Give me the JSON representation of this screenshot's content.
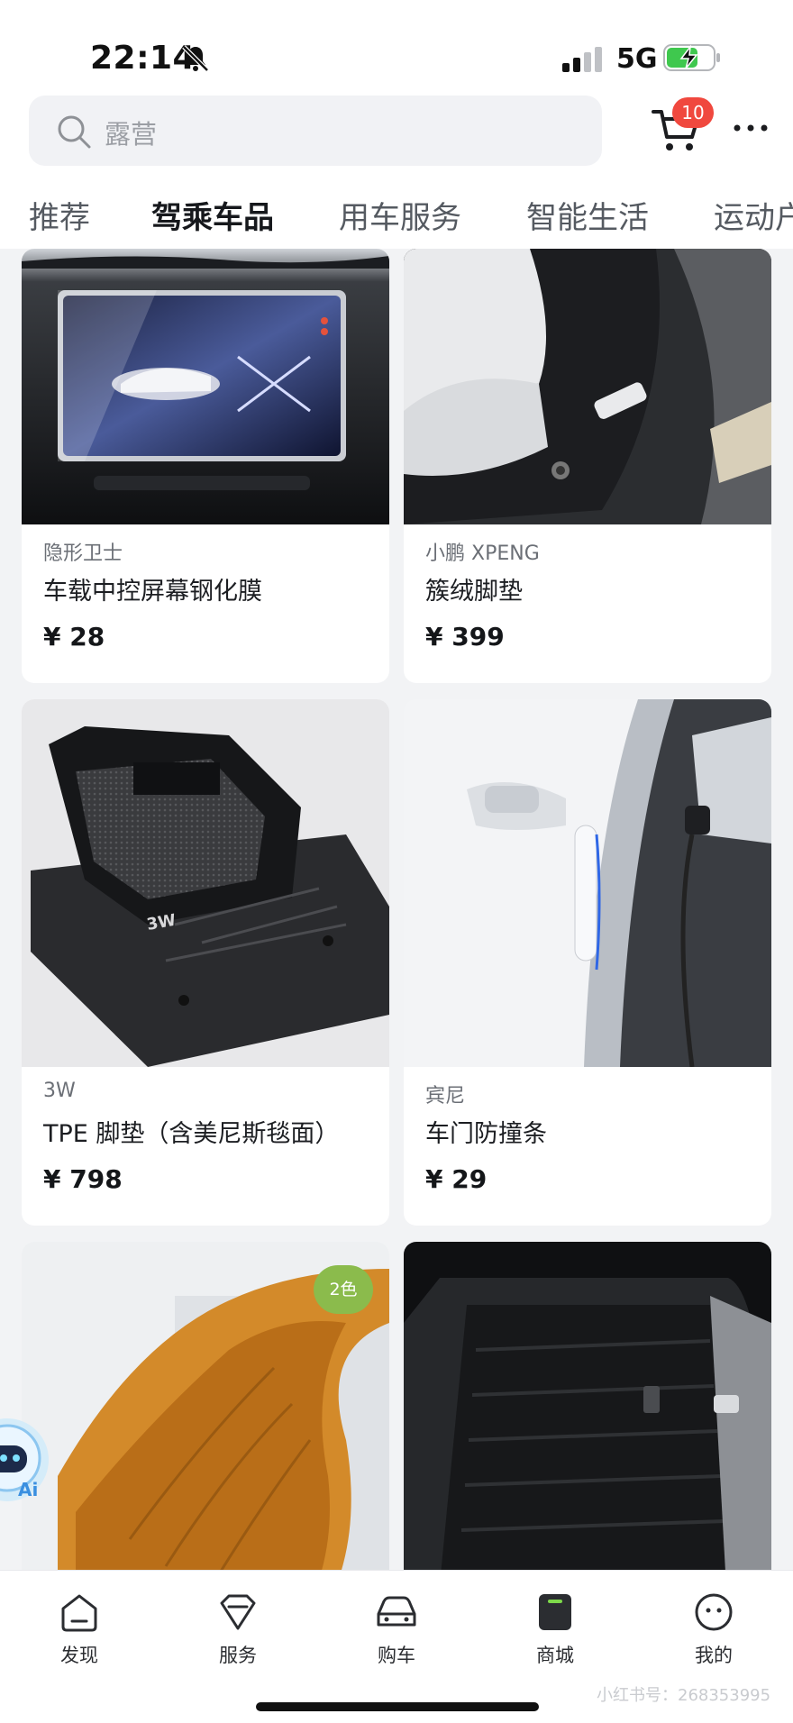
{
  "status_bar": {
    "time": "22:14",
    "network": "5G",
    "icons": [
      "bell-slash-icon",
      "signal-icon",
      "battery-charging-icon"
    ]
  },
  "search": {
    "placeholder": "露营"
  },
  "header": {
    "cart_badge": "10",
    "icons": [
      "search-icon",
      "cart-icon",
      "more-icon"
    ]
  },
  "tabs": [
    {
      "label": "推荐",
      "active": false
    },
    {
      "label": "驾乘车品",
      "active": true
    },
    {
      "label": "用车服务",
      "active": false
    },
    {
      "label": "智能生活",
      "active": false
    },
    {
      "label": "运动户",
      "active": false
    }
  ],
  "products": [
    {
      "brand": "隐形卫士",
      "title": "车载中控屏幕钢化膜",
      "price": "¥ 28"
    },
    {
      "brand": "小鹏 XPENG",
      "title": "簇绒脚垫",
      "price": "¥ 399"
    },
    {
      "brand": "3W",
      "title": "TPE 脚垫（含美尼斯毯面）",
      "price": "¥ 798"
    },
    {
      "brand": "宾尼",
      "title": "车门防撞条",
      "price": "¥ 29"
    }
  ],
  "partial_products": {
    "color_badge": "2色"
  },
  "bottom_nav": [
    {
      "label": "发现",
      "icon": "discover-icon"
    },
    {
      "label": "服务",
      "icon": "service-icon"
    },
    {
      "label": "购车",
      "icon": "car-icon"
    },
    {
      "label": "商城",
      "icon": "store-icon"
    },
    {
      "label": "我的",
      "icon": "profile-icon"
    }
  ],
  "watermark": "小红书号：268353995",
  "colors": {
    "accent_red": "#f0483e",
    "badge_green": "#8bbb4c",
    "background": "#f2f3f5"
  }
}
